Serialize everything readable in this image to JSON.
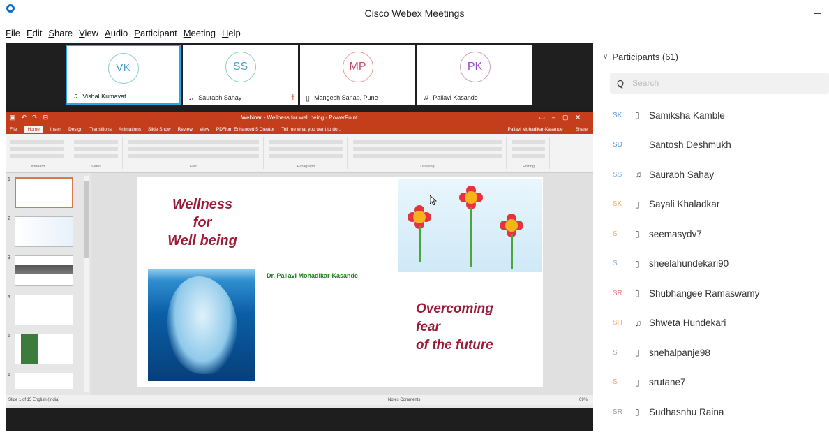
{
  "window": {
    "title": "Cisco Webex Meetings",
    "minimize": "–"
  },
  "menu": [
    "File",
    "Edit",
    "Share",
    "View",
    "Audio",
    "Participant",
    "Meeting",
    "Help"
  ],
  "video_strip": [
    {
      "initials": "VK",
      "name": "Vishal Kumavat",
      "color": "#4aa0c9",
      "status_icon": "audio-icon"
    },
    {
      "initials": "SS",
      "name": "Saurabh Sahay",
      "color": "#4aa0c9",
      "status_icon": "audio-icon",
      "muted": "🎙"
    },
    {
      "initials": "MP",
      "name": "Mangesh Sanap, Pune",
      "color": "#c94a6a",
      "status_icon": "phone-icon"
    },
    {
      "initials": "PK",
      "name": "Pallavi Kasande",
      "color": "#9a4ac9",
      "status_icon": "audio-icon"
    }
  ],
  "ppt": {
    "title": "Webinar - Wellness for well being - PowerPoint",
    "tabs": [
      "File",
      "Home",
      "Insert",
      "Design",
      "Transitions",
      "Animations",
      "Slide Show",
      "Review",
      "View",
      "PDFium Enhanced 5 Creator",
      "Tell me what you want to do..."
    ],
    "user": "Pallavi Mohadikar-Kasande",
    "share": "Share",
    "ribbon_groups": [
      "Clipboard",
      "Slides",
      "Font",
      "Paragraph",
      "Drawing",
      "Editing"
    ],
    "slide_numbers": [
      "1",
      "2",
      "3",
      "4",
      "5",
      "6"
    ],
    "slide": {
      "wellness_lines": [
        "Wellness",
        "for",
        "Well being"
      ],
      "author": "Dr. Pallavi Mohadikar-Kasande",
      "overcoming_lines": [
        "Overcoming",
        "fear",
        "of the future"
      ]
    },
    "status_left": "Slide 1 of 15     English (India)",
    "status_right": "Notes   Comments",
    "zoom": "69%"
  },
  "participants": {
    "header": "Participants (61)",
    "search_placeholder": "Search",
    "list": [
      {
        "initials": "SK",
        "name": "Samiksha Kamble",
        "icon": "device-icon"
      },
      {
        "initials": "SD",
        "name": "Santosh Deshmukh",
        "icon": ""
      },
      {
        "initials": "SS",
        "name": "Saurabh Sahay",
        "icon": "audio-icon"
      },
      {
        "initials": "SK",
        "name": "Sayali Khaladkar",
        "icon": "device-icon"
      },
      {
        "initials": "S",
        "name": "seemasydv7",
        "icon": "device-icon"
      },
      {
        "initials": "S",
        "name": "sheelahundekari90",
        "icon": "device-icon"
      },
      {
        "initials": "SR",
        "name": "Shubhangee Ramaswamy",
        "icon": "device-icon"
      },
      {
        "initials": "SH",
        "name": "Shweta Hundekari",
        "icon": "audio-icon"
      },
      {
        "initials": "S",
        "name": "snehalpanje98",
        "icon": "device-icon"
      },
      {
        "initials": "S",
        "name": "srutane7",
        "icon": "device-icon"
      },
      {
        "initials": "SR",
        "name": "Sudhasnhu Raina",
        "icon": "device-icon"
      }
    ],
    "initial_colors": [
      "#5b9bd5",
      "#5b9bd5",
      "#7fb0d8",
      "#f0b070",
      "#f0b070",
      "#7fb0d8",
      "#e58080",
      "#f0b070",
      "#aaaaaa",
      "#f0a070",
      "#999999"
    ]
  }
}
